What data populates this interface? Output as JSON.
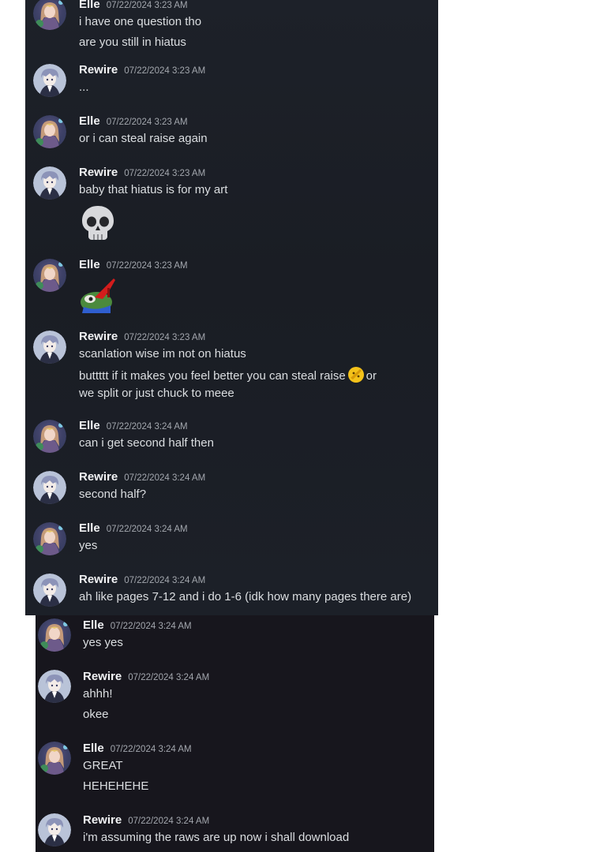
{
  "messages_top": [
    {
      "author": "Elle",
      "time": "07/22/2024 3:23 AM",
      "lines": [
        "i have one question tho",
        "are you still in hiatus"
      ]
    },
    {
      "author": "Rewire",
      "time": "07/22/2024 3:23 AM",
      "lines": [
        "..."
      ]
    },
    {
      "author": "Elle",
      "time": "07/22/2024 3:23 AM",
      "lines": [
        "or i can steal raise again"
      ]
    },
    {
      "author": "Rewire",
      "time": "07/22/2024 3:23 AM",
      "lines": [
        "baby that hiatus is for my art"
      ],
      "emoji": "skull-emoji"
    },
    {
      "author": "Elle",
      "time": "07/22/2024 3:23 AM",
      "lines": [],
      "emoji": "pepe-heel-sticker"
    },
    {
      "author": "Rewire",
      "time": "07/22/2024 3:23 AM",
      "lines": [
        "scanlation wise im not on hiatus",
        "buttttt if it makes you feel better you can steal raise",
        "or",
        "we split or just chuck to meee"
      ],
      "inline_emoji": "yellow-emote"
    },
    {
      "author": "Elle",
      "time": "07/22/2024 3:24 AM",
      "lines": [
        "can i get second half then"
      ]
    },
    {
      "author": "Rewire",
      "time": "07/22/2024 3:24 AM",
      "lines": [
        "second half?"
      ]
    },
    {
      "author": "Elle",
      "time": "07/22/2024 3:24 AM",
      "lines": [
        "yes"
      ]
    },
    {
      "author": "Rewire",
      "time": "07/22/2024 3:24 AM",
      "lines": [
        "ah like pages 7-12 and i do 1-6 (idk how many pages there are)"
      ]
    }
  ],
  "messages_bottom": [
    {
      "author": "Elle",
      "time": "07/22/2024 3:24 AM",
      "lines": [
        "yes yes"
      ]
    },
    {
      "author": "Rewire",
      "time": "07/22/2024 3:24 AM",
      "lines": [
        "ahhh!",
        "okee"
      ]
    },
    {
      "author": "Elle",
      "time": "07/22/2024 3:24 AM",
      "lines": [
        "GREAT",
        "HEHEHEHE"
      ]
    },
    {
      "author": "Rewire",
      "time": "07/22/2024 3:24 AM",
      "lines": [
        "i'm assuming the raws are up now i shall download"
      ]
    }
  ],
  "colors": {
    "panel_top": "#1d2129",
    "panel_bottom": "#17161d",
    "author": "#f2f3f5",
    "text": "#dbdee1",
    "timestamp": "#a3a7ae"
  }
}
